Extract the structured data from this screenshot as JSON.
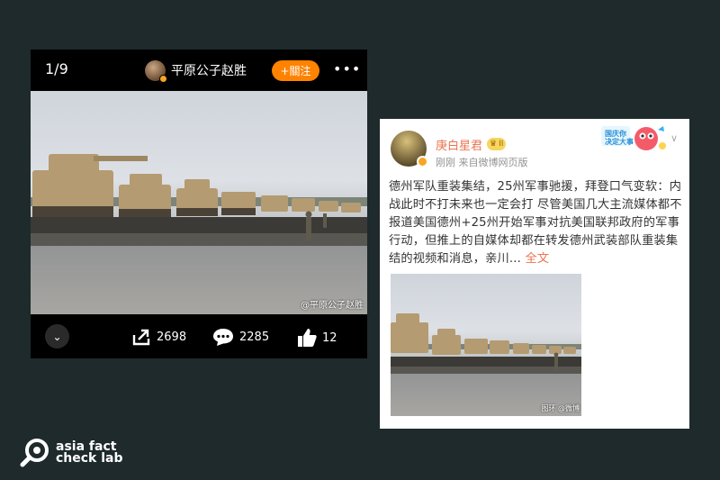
{
  "viewer": {
    "counter": "1/9",
    "author": "平原公子赵胜",
    "follow_label": "+關注",
    "more_label": "•••",
    "watermark": "@平原公子赵胜",
    "shares": "2698",
    "comments": "2285",
    "likes": "12"
  },
  "post": {
    "author": "庚白星君",
    "vip_level": "II",
    "meta": "刚刚  来自微博网页版",
    "decor_label": "国庆你\n决定大事",
    "text": "德州军队重装集结，25州军事驰援，拜登口气变软：内战此时不打未来也一定会打  尽管美国几大主流媒体都不报道美国德州+25州开始军事对抗美国联邦政府的军事行动，但推上的自媒体却都在转发德州武装部队重装集结的视频和消息，亲川...",
    "full_text_link": "全文",
    "image_watermark": "图环  @微博"
  },
  "brand": {
    "line1": "asia fact",
    "line2": "check lab"
  },
  "colors": {
    "background": "#1e2a2b",
    "weibo_orange": "#ff8200",
    "username": "#eb7350"
  },
  "icons": [
    "chevron-down-icon",
    "share-icon",
    "comment-icon",
    "like-icon",
    "search-magnifier-logo"
  ]
}
